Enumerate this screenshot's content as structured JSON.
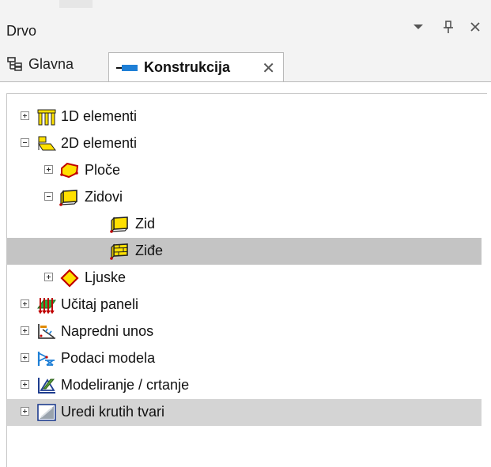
{
  "panel": {
    "title": "Drvo",
    "controls": {
      "menu_icon": "chevron-down-icon",
      "pin_icon": "pin-icon",
      "close_icon": "close-icon"
    }
  },
  "tabs": [
    {
      "label": "Glavna",
      "icon": "tree-structure-icon"
    },
    {
      "label": "Konstrukcija",
      "icon": "beam-icon",
      "active": true,
      "close_icon": "close-icon"
    }
  ],
  "tree": {
    "nodes": [
      {
        "label": "1D elementi",
        "icon": "1d-elements-icon",
        "state": "collapsed"
      },
      {
        "label": "2D elementi",
        "icon": "2d-elements-icon",
        "state": "expanded"
      },
      {
        "label": "Ploče",
        "icon": "slab-icon",
        "state": "collapsed"
      },
      {
        "label": "Zidovi",
        "icon": "walls-icon",
        "state": "expanded"
      },
      {
        "label": "Zid",
        "icon": "wall-icon"
      },
      {
        "label": "Ziđe",
        "icon": "masonry-icon",
        "selected": true
      },
      {
        "label": "Ljuske",
        "icon": "shells-icon",
        "state": "collapsed"
      },
      {
        "label": "Učitaj paneli",
        "icon": "load-panels-icon",
        "state": "collapsed"
      },
      {
        "label": "Napredni unos",
        "icon": "advanced-input-icon",
        "state": "collapsed"
      },
      {
        "label": "Podaci modela",
        "icon": "model-data-icon",
        "state": "collapsed"
      },
      {
        "label": "Modeliranje / crtanje",
        "icon": "modeling-drawing-icon",
        "state": "collapsed"
      },
      {
        "label": "Uredi krutih tvari",
        "icon": "rigid-bodies-icon",
        "state": "collapsed",
        "highlighted": true
      }
    ]
  },
  "colors": {
    "panel_bg": "#f3f3f3",
    "selection": "#c4c4c4",
    "hover_row": "#d4d4d4",
    "tab_accent_blue": "#1e7fd6"
  }
}
